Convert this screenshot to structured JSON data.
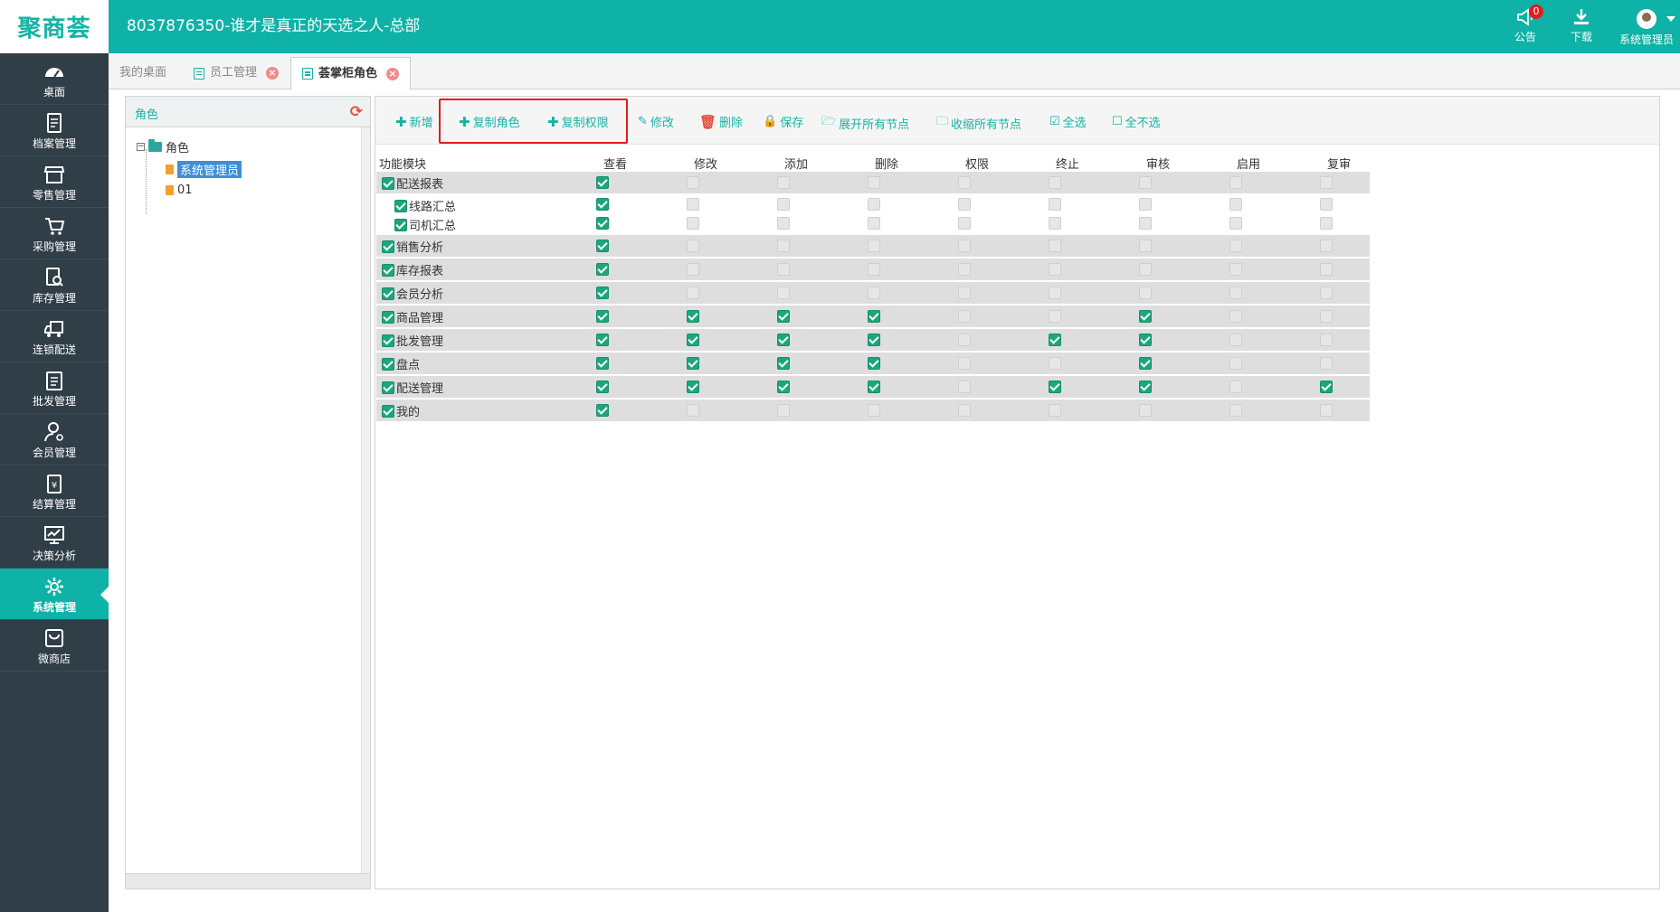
{
  "header": {
    "logo": "聚商荟",
    "title": "8037876350-谁才是真正的天选之人-总部",
    "notice_label": "公告",
    "notice_count": "0",
    "download_label": "下载",
    "user_label": "系统管理员"
  },
  "sidebar": {
    "items": [
      {
        "label": "桌面",
        "icon": "dashboard-icon"
      },
      {
        "label": "档案管理",
        "icon": "archive-icon"
      },
      {
        "label": "零售管理",
        "icon": "store-icon"
      },
      {
        "label": "采购管理",
        "icon": "cart-icon"
      },
      {
        "label": "库存管理",
        "icon": "inventory-icon"
      },
      {
        "label": "连锁配送",
        "icon": "truck-icon"
      },
      {
        "label": "批发管理",
        "icon": "wholesale-icon"
      },
      {
        "label": "会员管理",
        "icon": "member-icon"
      },
      {
        "label": "结算管理",
        "icon": "settlement-icon"
      },
      {
        "label": "决策分析",
        "icon": "chart-icon"
      },
      {
        "label": "系统管理",
        "icon": "gear-icon"
      },
      {
        "label": "微商店",
        "icon": "shop-bag-icon"
      }
    ],
    "active_index": 10
  },
  "tabs": [
    {
      "label": "我的桌面"
    },
    {
      "label": "员工管理"
    },
    {
      "label": "荟掌柜角色"
    }
  ],
  "tree": {
    "header": "角色",
    "root": "角色",
    "children": [
      "系统管理员",
      "01"
    ],
    "selected": "系统管理员"
  },
  "toolbar": {
    "add": "新增",
    "copy_role": "复制角色",
    "copy_perm": "复制权限",
    "edit": "修改",
    "delete": "删除",
    "save": "保存",
    "expand_all": "展开所有节点",
    "collapse_all": "收缩所有节点",
    "select_all": "全选",
    "select_none": "全不选"
  },
  "grid": {
    "columns": [
      "功能模块",
      "查看",
      "修改",
      "添加",
      "删除",
      "权限",
      "终止",
      "审核",
      "启用",
      "复审"
    ],
    "rows": [
      {
        "label": "配送报表",
        "level": 0,
        "checked": true,
        "perms": [
          1,
          0,
          0,
          0,
          0,
          0,
          0,
          0,
          0
        ]
      },
      {
        "label": "线路汇总",
        "level": 1,
        "checked": true,
        "perms": [
          1,
          0,
          0,
          0,
          0,
          0,
          0,
          0,
          0
        ]
      },
      {
        "label": "司机汇总",
        "level": 1,
        "checked": true,
        "perms": [
          1,
          0,
          0,
          0,
          0,
          0,
          0,
          0,
          0
        ]
      },
      {
        "label": "销售分析",
        "level": 0,
        "checked": true,
        "perms": [
          1,
          0,
          0,
          0,
          0,
          0,
          0,
          0,
          0
        ]
      },
      {
        "label": "库存报表",
        "level": 0,
        "checked": true,
        "perms": [
          1,
          0,
          0,
          0,
          0,
          0,
          0,
          0,
          0
        ]
      },
      {
        "label": "会员分析",
        "level": 0,
        "checked": true,
        "perms": [
          1,
          0,
          0,
          0,
          0,
          0,
          0,
          0,
          0
        ]
      },
      {
        "label": "商品管理",
        "level": 0,
        "checked": true,
        "perms": [
          1,
          1,
          1,
          1,
          0,
          0,
          1,
          0,
          0
        ]
      },
      {
        "label": "批发管理",
        "level": 0,
        "checked": true,
        "perms": [
          1,
          1,
          1,
          1,
          0,
          1,
          1,
          0,
          0
        ]
      },
      {
        "label": "盘点",
        "level": 0,
        "checked": true,
        "perms": [
          1,
          1,
          1,
          1,
          0,
          0,
          1,
          0,
          0
        ]
      },
      {
        "label": "配送管理",
        "level": 0,
        "checked": true,
        "perms": [
          1,
          1,
          1,
          1,
          0,
          1,
          1,
          0,
          1
        ]
      },
      {
        "label": "我的",
        "level": 0,
        "checked": true,
        "perms": [
          1,
          0,
          0,
          0,
          0,
          0,
          0,
          0,
          0
        ]
      }
    ]
  },
  "colors": {
    "brand": "#0fb2a7",
    "sidebar": "#2f3e47",
    "check": "#1ba77d",
    "highlight_box": "#e51c1c"
  }
}
